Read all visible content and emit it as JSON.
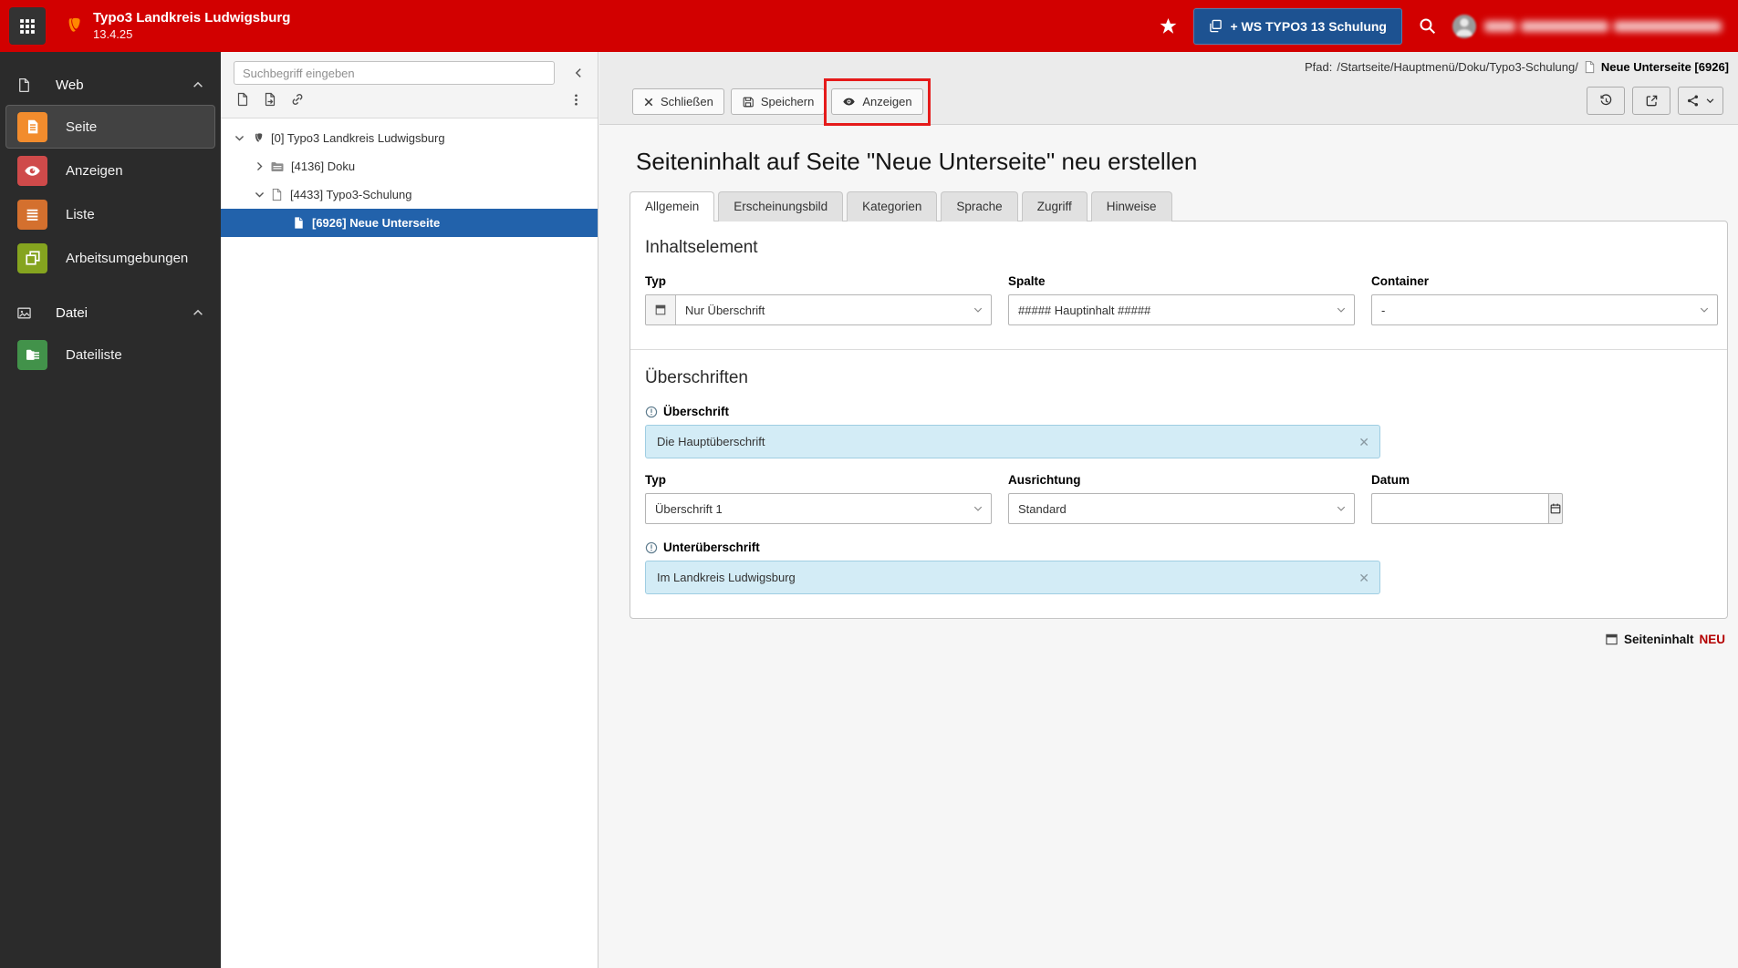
{
  "topbar": {
    "title": "Typo3 Landkreis Ludwigsburg",
    "version": "13.4.25",
    "workspace_button": "+ WS TYPO3 13 Schulung"
  },
  "sidebar": {
    "groups": [
      {
        "label": "Web",
        "items": [
          {
            "label": "Seite",
            "active": true
          },
          {
            "label": "Anzeigen"
          },
          {
            "label": "Liste"
          },
          {
            "label": "Arbeitsumgebungen"
          }
        ]
      },
      {
        "label": "Datei",
        "items": [
          {
            "label": "Dateiliste"
          }
        ]
      }
    ]
  },
  "pagetree": {
    "search_placeholder": "Suchbegriff eingeben",
    "nodes": [
      {
        "label": "[0] Typo3 Landkreis Ludwigsburg",
        "level": 0,
        "state": "expanded",
        "icon": "typo3-logo-icon"
      },
      {
        "label": "[4136] Doku",
        "level": 1,
        "state": "collapsed",
        "icon": "folder-icon"
      },
      {
        "label": "[4433] Typo3-Schulung",
        "level": 1,
        "state": "expanded",
        "icon": "page-icon"
      },
      {
        "label": "[6926] Neue Unterseite",
        "level": 2,
        "state": "selected",
        "icon": "page-icon"
      }
    ]
  },
  "docheader": {
    "path_label": "Pfad:",
    "path": "/Startseite/Hauptmenü/Doku/Typo3-Schulung/",
    "record": "Neue Unterseite [6926]",
    "buttons": {
      "close": "Schließen",
      "save": "Speichern",
      "view": "Anzeigen"
    }
  },
  "form": {
    "title": "Seiteninhalt auf Seite \"Neue Unterseite\" neu erstellen",
    "tabs": [
      "Allgemein",
      "Erscheinungsbild",
      "Kategorien",
      "Sprache",
      "Zugriff",
      "Hinweise"
    ],
    "active_tab": "Allgemein",
    "sections": {
      "inhaltselement": {
        "heading": "Inhaltselement",
        "typ": {
          "label": "Typ",
          "value": "Nur Überschrift"
        },
        "spalte": {
          "label": "Spalte",
          "value": "##### Hauptinhalt #####"
        },
        "container": {
          "label": "Container",
          "value": "-"
        }
      },
      "ueberschriften": {
        "heading": "Überschriften",
        "ueberschrift": {
          "label": "Überschrift",
          "value": "Die Hauptüberschrift"
        },
        "typ": {
          "label": "Typ",
          "value": "Überschrift 1"
        },
        "ausrichtung": {
          "label": "Ausrichtung",
          "value": "Standard"
        },
        "datum": {
          "label": "Datum",
          "value": ""
        },
        "unterueberschrift": {
          "label": "Unterüberschrift",
          "value": "Im Landkreis Ludwigsburg"
        }
      }
    }
  },
  "footer": {
    "record_type": "Seiteninhalt",
    "state": "NEU"
  },
  "icons": {
    "modmenu": "grid-icon",
    "favorites": "star-icon",
    "workspace": "copy-squares-icon",
    "search": "magnifier-icon",
    "user": "avatar-icon",
    "close": "x-icon",
    "save": "floppy-icon",
    "view": "eye-icon",
    "history": "circular-arrow-icon",
    "open_new_window": "external-link-icon",
    "share": "share-nodes-icon",
    "date": "calendar-icon",
    "field_info": "info-circle-icon",
    "content_element": "header-block-icon"
  },
  "colors": {
    "topbar-red": "#d20000",
    "workspace-blue": "#1d5291",
    "tree-selected-blue": "#2262ab",
    "annotation-red": "#e51a1a",
    "field-blue-bg": "#d3ecf6",
    "field-blue-border": "#9fcde2",
    "module-seite-orange": "#f28c2d",
    "module-anzeigen-red": "#cf4a4a",
    "module-liste-orange": "#d4702e",
    "module-arbeitsumgebungen-green": "#85a41f",
    "module-dateiliste-green": "#42924a",
    "neu-red": "#b30000"
  }
}
